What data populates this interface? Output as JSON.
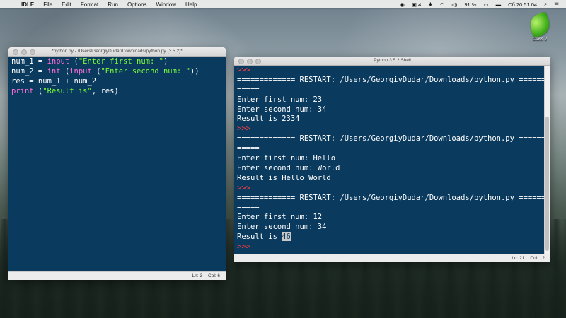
{
  "menubar": {
    "apple": "",
    "app": "IDLE",
    "items": [
      "File",
      "Edit",
      "Format",
      "Run",
      "Options",
      "Window",
      "Help"
    ],
    "status": {
      "record": "◉",
      "display_num": "4",
      "battery": "91 %",
      "clock": "Сб 20:51:04"
    }
  },
  "desktop": {
    "icon_label": "Class 2"
  },
  "editor": {
    "title": "*python.py - /Users/GeorgiyDudar/Downloads/python.py (3.5.2)*",
    "lines": [
      [
        {
          "t": "num_1 = ",
          "c": "plain"
        },
        {
          "t": "input",
          "c": "kw"
        },
        {
          "t": " (",
          "c": "plain"
        },
        {
          "t": "\"Enter first num: \"",
          "c": "str"
        },
        {
          "t": ")",
          "c": "plain"
        }
      ],
      [
        {
          "t": "num_2 = ",
          "c": "plain"
        },
        {
          "t": "int",
          "c": "kw"
        },
        {
          "t": " (",
          "c": "plain"
        },
        {
          "t": "input",
          "c": "kw"
        },
        {
          "t": " (",
          "c": "plain"
        },
        {
          "t": "\"Enter second num: \"",
          "c": "str"
        },
        {
          "t": "))",
          "c": "plain"
        }
      ],
      [
        {
          "t": "res = num_1 + num_2",
          "c": "plain"
        }
      ],
      [
        {
          "t": "print",
          "c": "kw"
        },
        {
          "t": " (",
          "c": "plain"
        },
        {
          "t": "\"Result is\"",
          "c": "str"
        },
        {
          "t": ", res)",
          "c": "plain"
        }
      ]
    ],
    "status": {
      "ln": "Ln: 3",
      "col": "Col: 6"
    }
  },
  "shell": {
    "title": "Python 3.5.2 Shell",
    "lines": [
      {
        "t": ">>> ",
        "c": "prompt"
      },
      {
        "t": "============= RESTART: /Users/GeorgiyDudar/Downloads/python.py ========",
        "c": "restart"
      },
      {
        "t": "=====",
        "c": "restart"
      },
      {
        "t": "Enter first num: 23",
        "c": "plain"
      },
      {
        "t": "Enter second num: 34",
        "c": "plain"
      },
      {
        "t": "Result is 2334",
        "c": "plain"
      },
      {
        "t": ">>> ",
        "c": "prompt"
      },
      {
        "t": "============= RESTART: /Users/GeorgiyDudar/Downloads/python.py ========",
        "c": "restart"
      },
      {
        "t": "=====",
        "c": "restart"
      },
      {
        "t": "Enter first num: Hello",
        "c": "plain"
      },
      {
        "t": "Enter second num: World",
        "c": "plain"
      },
      {
        "t": "Result is Hello World",
        "c": "plain"
      },
      {
        "t": ">>> ",
        "c": "prompt"
      },
      {
        "t": "============= RESTART: /Users/GeorgiyDudar/Downloads/python.py ========",
        "c": "restart"
      },
      {
        "t": "=====",
        "c": "restart"
      },
      {
        "t": "Enter first num: 12",
        "c": "plain"
      },
      {
        "t": "Enter second num: 34",
        "c": "plain"
      },
      {
        "t": "Result is ",
        "c": "plain",
        "sel": "46"
      },
      {
        "t": ">>> ",
        "c": "prompt"
      }
    ],
    "status": {
      "ln": "Ln: 21",
      "col": "Col: 12"
    }
  },
  "colors": {
    "editor_bg": "#0a3a5e",
    "keyword": "#ff6fd8",
    "string": "#7cfc3a",
    "prompt": "#ff3b3b"
  }
}
